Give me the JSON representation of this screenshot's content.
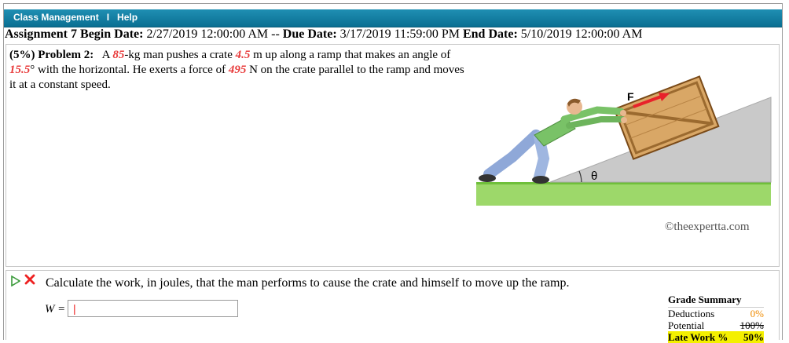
{
  "menu": {
    "items": [
      "Class Management",
      "Help"
    ],
    "separator": "I"
  },
  "assignment": {
    "title": "Assignment 7",
    "begin_label": "Begin Date:",
    "begin_value": "2/27/2019 12:00:00 AM",
    "dash": "--",
    "due_label": "Due Date:",
    "due_value": "3/17/2019 11:59:00 PM",
    "end_label": "End Date:",
    "end_value": "5/10/2019 12:00:00 AM"
  },
  "problem": {
    "weight": "(5%)",
    "label": "Problem 2:",
    "text_1": "A ",
    "mass": "85",
    "text_2": "-kg man pushes a crate ",
    "distance": "4.5",
    "text_3": " m up along a ramp that makes an angle of ",
    "angle": "15.5",
    "text_4": "° with the horizontal. He exerts a force of ",
    "force": "495",
    "text_5": " N on the crate parallel to the ramp and moves it at a constant speed."
  },
  "figure": {
    "force_label": "F",
    "angle_label": "θ",
    "credit": "©theexpertta.com"
  },
  "part": {
    "question": "Calculate the work, in joules, that the man performs to cause the crate and himself to move up the ramp.",
    "var_label": "W",
    "equals": "=",
    "input_value": "|"
  },
  "grade_summary": {
    "title": "Grade Summary",
    "rows": [
      {
        "label": "Deductions",
        "value": "0%"
      },
      {
        "label": "Potential",
        "value": "100%"
      },
      {
        "label": "Late Work %",
        "value": "50%"
      }
    ]
  },
  "colors": {
    "topbar": "#0a7fa6",
    "highlight_red": "#e83a3a",
    "late_highlight": "#f4f000"
  }
}
